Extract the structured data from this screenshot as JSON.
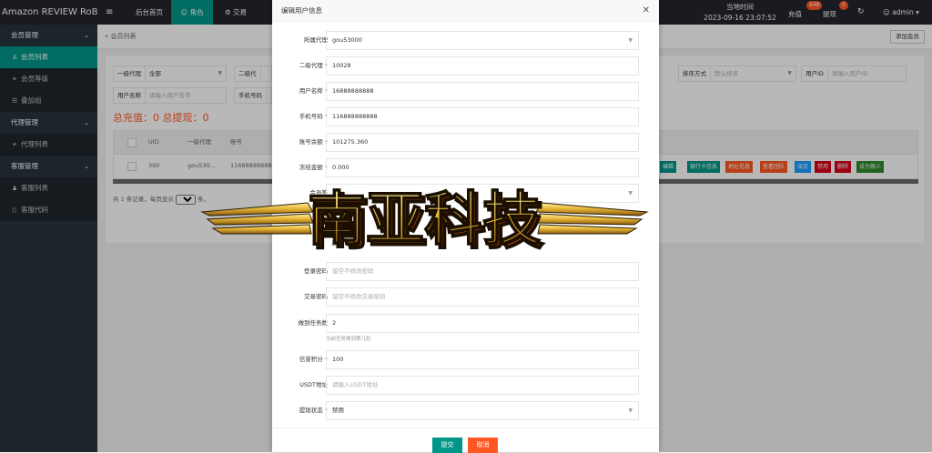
{
  "topbar": {
    "brand": "Amazon REVIEW RoB...",
    "menu_icon": "≡",
    "nav": [
      "后台首页",
      "角色",
      "交易"
    ],
    "time_label": "当地时间",
    "time_value": "2023-09-16 23:07:52",
    "recharge_label": "充值",
    "recharge_badge": "948",
    "withdraw_label": "提现",
    "withdraw_badge": "0",
    "refresh_icon": "↻",
    "user": "admin"
  },
  "sidebar": {
    "groups": [
      {
        "label": "会员管理",
        "items": [
          "会员列表",
          "会员等级",
          "叠加组"
        ]
      },
      {
        "label": "代理管理",
        "items": [
          "代理列表"
        ]
      },
      {
        "label": "客服管理",
        "items": [
          "客服列表",
          "客服代码"
        ]
      }
    ],
    "active_item": "会员列表"
  },
  "breadcrumb": "会员列表",
  "add_button": "添加会员",
  "filters": {
    "agent1": {
      "label": "一级代理",
      "value": "全部"
    },
    "agent2": {
      "label": "二级代"
    },
    "sort": {
      "label": "排序方式",
      "placeholder": "默认排序"
    },
    "userid": {
      "label": "用户ID",
      "placeholder": "请输入用户ID"
    },
    "username": {
      "label": "用户名称",
      "placeholder": "请输入用户名字"
    },
    "phone": {
      "label": "手机号码"
    }
  },
  "totals": "总充值：0 总提现：0",
  "table": {
    "headers": [
      "UID",
      "一级代理",
      "账号"
    ],
    "row": {
      "uid": "390",
      "agent1": "gou530...",
      "account": "116888888888"
    },
    "actions": [
      {
        "label": "编辑",
        "color": "#009688"
      },
      {
        "label": "银行卡信息",
        "color": "#009688"
      },
      {
        "label": "地址信息",
        "color": "#ff5722"
      },
      {
        "label": "查看团队",
        "color": "#ff5722"
      },
      {
        "label": "派交",
        "color": "#1e9fff"
      },
      {
        "label": "禁用",
        "color": "#d9001b"
      },
      {
        "label": "删除",
        "color": "#d9001b"
      },
      {
        "label": "设为假人",
        "color": "#2f8a2f"
      }
    ]
  },
  "pager": {
    "prefix": "共 1 条记录，每页显示",
    "size": "20",
    "suffix": "条，"
  },
  "modal": {
    "title": "编辑用户信息",
    "close": "✕",
    "fields": [
      {
        "label": "所属代理",
        "value": "gou53000",
        "select": true,
        "required": false
      },
      {
        "label": "二级代理",
        "value": "10028",
        "required": true
      },
      {
        "label": "用户名称",
        "value": "16888888888",
        "required": true
      },
      {
        "label": "手机号码",
        "value": "116888888888",
        "required": true
      },
      {
        "label": "账号余额",
        "value": "101275.360",
        "required": true
      },
      {
        "label": "冻结金额",
        "value": "0.000",
        "required": true
      },
      {
        "label": "会员等",
        "value": "",
        "select": true,
        "required": false
      },
      {
        "label": "叠加",
        "value": "",
        "required": false
      },
      {
        "label": "",
        "value": "正常",
        "required": false
      },
      {
        "label": "登录密码",
        "placeholder": "留空不修改密码",
        "required": false
      },
      {
        "label": "交易密码",
        "placeholder": "留空不修改交易密码",
        "required": false
      },
      {
        "label": "做到任务数",
        "value": "2",
        "required": false
      },
      {
        "label": "信誉积分",
        "value": "100",
        "required": true
      },
      {
        "label": "USDT地址",
        "placeholder": "请输入USDT地址",
        "required": false
      },
      {
        "label": "提现状态",
        "value": "禁用",
        "select": true,
        "required": true
      }
    ],
    "task_hint": "当前任务做到第几轮",
    "submit": "提交",
    "cancel": "取消"
  },
  "watermark": "南亚科技",
  "colors": {
    "accent": "#009688",
    "danger": "#ff5722",
    "sidebar": "#28333e",
    "topbar": "#23262e"
  }
}
